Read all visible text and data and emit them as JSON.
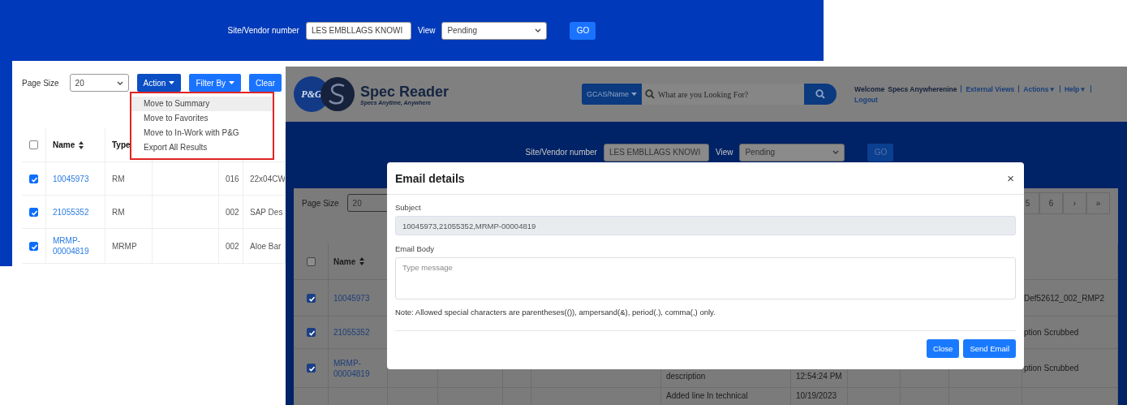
{
  "left_screen": {
    "filter_bar": {
      "site_label": "Site/Vendor number",
      "site_value": "LES EMBLLAGS KNOWI",
      "view_label": "View",
      "view_value": "Pending",
      "go_label": "GO"
    },
    "toolbar": {
      "page_size_label": "Page Size",
      "page_size_value": "20",
      "buttons": [
        {
          "label": "Action",
          "kind": "dropdown",
          "selected": true
        },
        {
          "label": "Filter By",
          "kind": "dropdown",
          "selected": false
        },
        {
          "label": "Clear",
          "kind": "plain",
          "selected": false
        }
      ]
    },
    "action_menu": [
      {
        "label": "Move to Summary",
        "highlighted": true
      },
      {
        "label": "Move to Favorites",
        "highlighted": false
      },
      {
        "label": "Move to In-Work with P&G",
        "highlighted": false
      },
      {
        "label": "Export All Results",
        "highlighted": false
      }
    ],
    "table": {
      "all_checked": false,
      "columns": [
        {
          "label": "Name",
          "sortable": true
        },
        {
          "label": "Type",
          "sortable": false
        }
      ],
      "rows": [
        {
          "checked": true,
          "name": "10045973",
          "type": "RM",
          "code": "016",
          "column_6": "22x04CW"
        },
        {
          "checked": true,
          "name": "21055352",
          "type": "RM",
          "code": "002",
          "column_6": "SAP Des"
        },
        {
          "checked": true,
          "name": "MRMP-00004819",
          "type": "MRMP",
          "code": "002",
          "column_6": "Aloe Bar"
        }
      ]
    }
  },
  "spec_screen": {
    "header": {
      "logo_text": "P&G",
      "app_title": "Spec Reader",
      "tagline": "Specs Anytime, Anywhere",
      "search": {
        "scope": "GCAS/Name",
        "placeholder": "What are you Looking For?"
      },
      "user_links": [
        {
          "text": "Welcome",
          "kind": "text"
        },
        {
          "text": "Specs Anywherenine",
          "kind": "text"
        },
        {
          "text": "External Views",
          "kind": "link"
        },
        {
          "text": "Actions▼",
          "kind": "link"
        },
        {
          "text": "Help▼",
          "kind": "link"
        },
        {
          "text": "Logout",
          "kind": "link"
        }
      ]
    },
    "filter_bar": {
      "site_label": "Site/Vendor number",
      "site_value": "LES EMBLLAGS KNOWI",
      "view_label": "View",
      "view_value": "Pending",
      "go_label": "GO"
    },
    "page_size": {
      "label": "Page Size",
      "value": "20"
    },
    "pagination": [
      "5",
      "6",
      "›",
      "»"
    ],
    "table": {
      "all_checked": false,
      "columns": [
        {
          "label": "Name",
          "sortable": true
        }
      ],
      "rows": [
        {
          "checked": true,
          "name": "10045973",
          "column_12": "Def52612_002_RMP2"
        },
        {
          "checked": true,
          "name": "21055352",
          "column_12": "ption Scrubbed"
        },
        {
          "checked": true,
          "name": "MRMP-00004819",
          "column_7": "description",
          "column_8": "12:54:24 PM",
          "column_12": "ption Scrubbed"
        },
        {
          "column_7": "Added line In technical",
          "column_8": "10/19/2023"
        }
      ]
    }
  },
  "email_modal": {
    "title": "Email details",
    "close_glyph": "×",
    "subject_label": "Subject",
    "subject_value": "10045973,21055352,MRMP-00004819",
    "body_label": "Email Body",
    "body_placeholder": "Type message",
    "note": "Note: Allowed special characters are parentheses(()), ampersand(&), period(.), comma(,) only.",
    "buttons": [
      {
        "label": "Close"
      },
      {
        "label": "Send Email"
      }
    ]
  }
}
